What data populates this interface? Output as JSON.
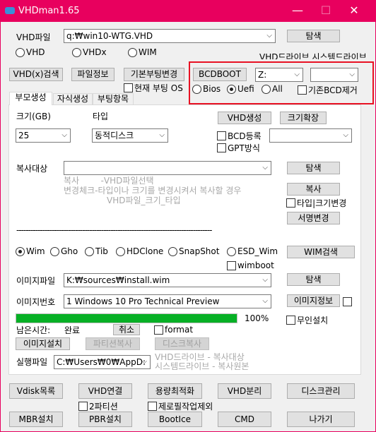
{
  "window": {
    "title": "VHDman1.65",
    "minimize": "—",
    "maximize": "☐",
    "close": "✕",
    "accent": "#e8005e"
  },
  "top": {
    "vhd_file_label": "VHD파일",
    "vhd_file_value": "q:₩win10-WTG.VHD",
    "browse": "탐색",
    "radios": [
      {
        "label": "VHD",
        "checked": false
      },
      {
        "label": "VHDx",
        "checked": false
      },
      {
        "label": "WIM",
        "checked": false
      }
    ],
    "drive_labels": "VHD드라이브  시스템드라이브",
    "buttons": {
      "search": "VHD(x)검색",
      "file_info": "파일정보",
      "default_boot": "기본부팅변경",
      "bcdboot": "BCDBOOT"
    },
    "current_boot_os": "현재 부팅 OS",
    "vhd_drive": "Z:",
    "system_drive": "",
    "boot_mode": [
      {
        "label": "Bios",
        "checked": false
      },
      {
        "label": "Uefi",
        "checked": true
      },
      {
        "label": "All",
        "checked": false
      }
    ],
    "remove_bcd": "기존BCD제거"
  },
  "tabs": [
    {
      "label": "부모생성",
      "selected": true
    },
    {
      "label": "자식생성",
      "selected": false
    },
    {
      "label": "부팅항목",
      "selected": false
    }
  ],
  "parent": {
    "size_label": "크기(GB)",
    "type_label": "타입",
    "size_value": "25",
    "type_value": "동적디스크",
    "create": "VHD생성",
    "expand": "크기확장",
    "bcd_register": "BCD등록",
    "bcd_combo": "",
    "gpt": "GPT방식",
    "copy_target_label": "복사대상",
    "copy_target_value": "",
    "browse": "탐색",
    "hint": [
      "복사        -VHD파일선택",
      "변경체크-타입이나  크기를 변경시켜서 복사할 경우",
      "VHD파일_크기_타입"
    ],
    "copy": "복사",
    "type_size_change": "타입|크기변경",
    "sign_change": "서명변경",
    "separator": "-----------------------------------------------------------------------------------"
  },
  "image": {
    "formats": [
      {
        "label": "Wim",
        "checked": true
      },
      {
        "label": "Gho",
        "checked": false
      },
      {
        "label": "Tib",
        "checked": false
      },
      {
        "label": "HDClone",
        "checked": false
      },
      {
        "label": "SnapShot",
        "checked": false
      },
      {
        "label": "ESD_Wim",
        "checked": false
      }
    ],
    "wim_search": "WIM검색",
    "wimboot": "wimboot",
    "file_label": "이미지파일",
    "file_value": "K:₩sources₩install.wim",
    "browse": "탐색",
    "index_label": "이미지번호",
    "index_value": "1  Windows 10 Pro Technical Preview",
    "info": "이미지정보",
    "progress_percent": 100,
    "progress_text": "100%",
    "progress_color": "#06b025",
    "unattended": "무인설치",
    "remaining_label": "남은시간:",
    "remaining_value": "완료",
    "cancel": "취소",
    "format": "format",
    "install": "이미지설치",
    "partition_copy": "파티션복사",
    "disk_copy": "디스크복사",
    "exec_label": "실행파일",
    "exec_value": "C:₩Users₩0₩AppD:",
    "exec_hint": [
      "VHD드라이브 - 복사대상",
      "시스템드라이브 - 복사원본"
    ]
  },
  "bottom": {
    "row1": [
      "Vdisk목록",
      "VHD연결",
      "용량최적화",
      "VHD분리",
      "디스크관리"
    ],
    "row2": [
      "MBR설치",
      "PBR설치",
      "BootIce",
      "CMD",
      "나가기"
    ],
    "two_partition": "2파티션",
    "skip_zero_fill": "제로필작업제외"
  }
}
